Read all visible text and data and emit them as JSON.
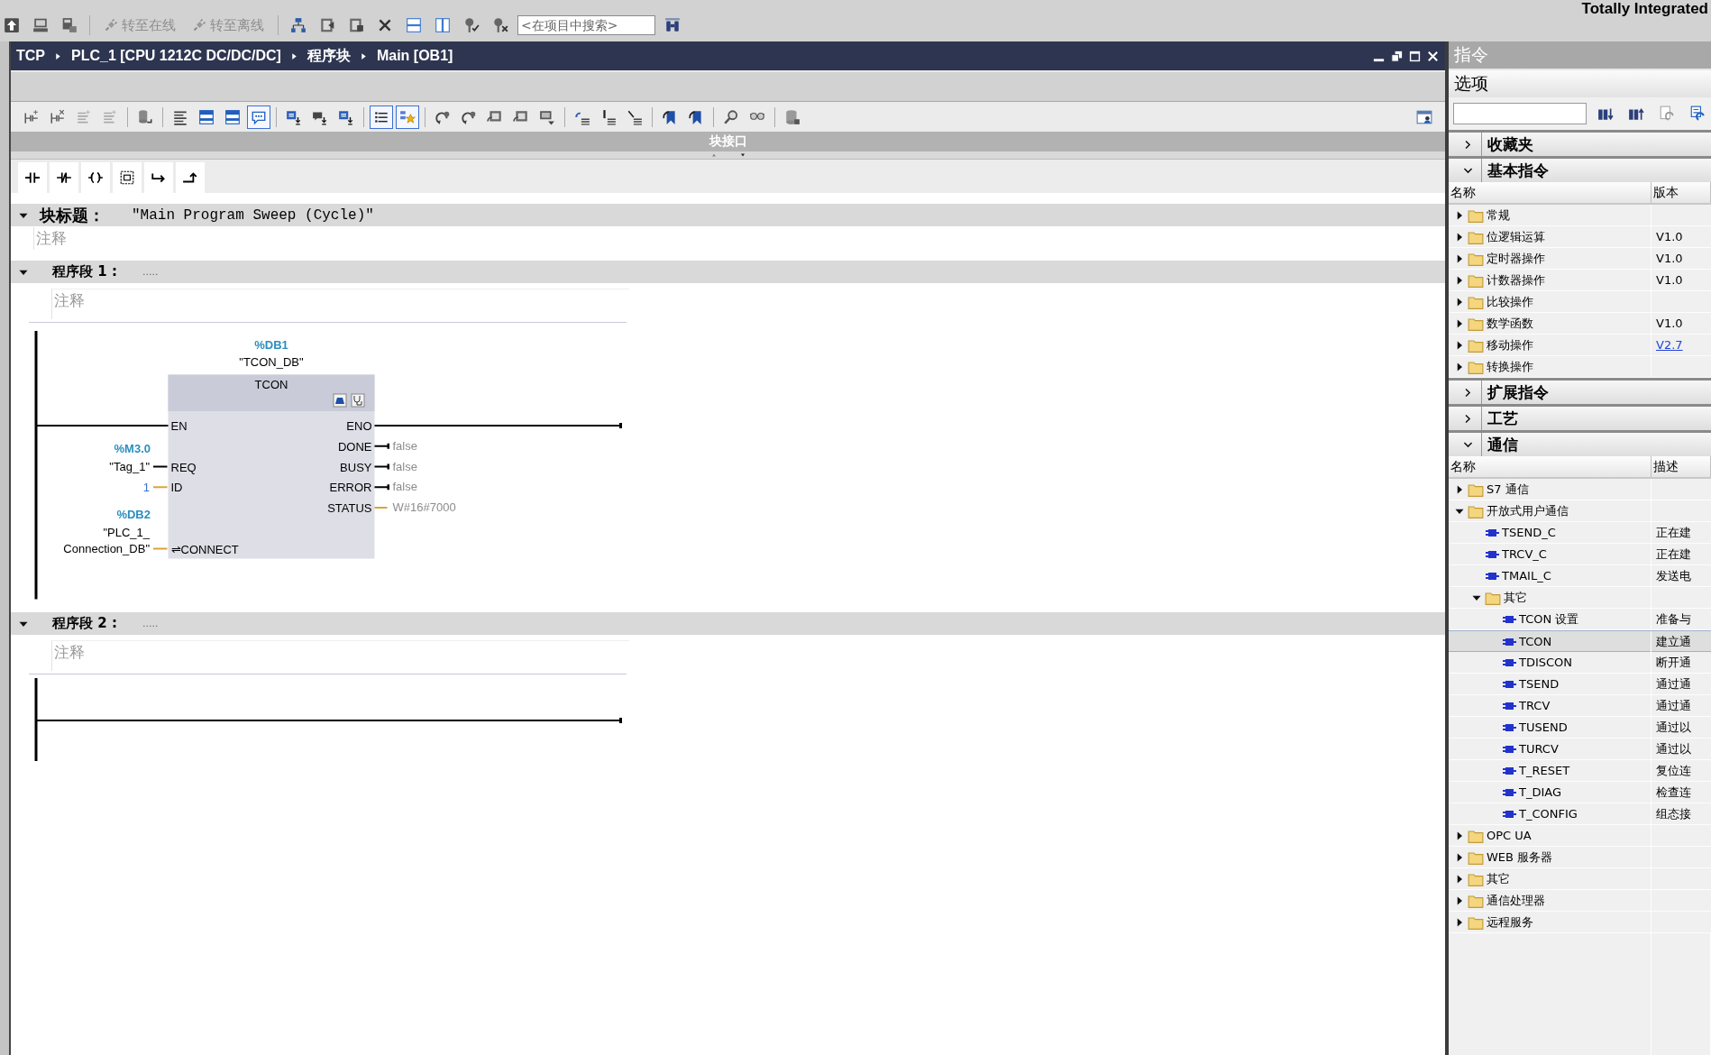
{
  "top_toolbar": {
    "buttons": [
      {
        "label": "转至在线",
        "disabled": true
      },
      {
        "label": "转至离线",
        "disabled": true
      }
    ],
    "search": {
      "placeholder": "<在项目中搜索>"
    }
  },
  "brand": "Totally Integrated",
  "editor": {
    "breadcrumb": [
      "TCP",
      "PLC_1 [CPU 1212C DC/DC/DC]",
      "程序块",
      "Main [OB1]"
    ],
    "toolbar": [
      {
        "on": false
      },
      {
        "on": false
      },
      {
        "on": false
      },
      {
        "on": false
      },
      {
        "on": false
      },
      {
        "on": false
      },
      {
        "on": false
      },
      {
        "on": false
      },
      {
        "on": true
      },
      {
        "on": false
      },
      {
        "on": false
      },
      {
        "on": false
      },
      {
        "on": true
      },
      {
        "on": true
      },
      {
        "on": false
      },
      {
        "on": false
      },
      {
        "on": false
      },
      {
        "on": false
      },
      {
        "on": false
      },
      {
        "on": false
      },
      {
        "on": false
      },
      {
        "on": false
      },
      {
        "on": false
      },
      {
        "on": false
      },
      {
        "on": false
      },
      {
        "on": false
      },
      {
        "on": false
      },
      {
        "on": false
      }
    ],
    "interface_bar": "块接口",
    "block_title": {
      "label": "块标题：",
      "value": "\"Main Program Sweep (Cycle)\"",
      "comment": "注释",
      "expanded": true
    },
    "networks": [
      {
        "title": "程序段 1 :",
        "dots": ".....",
        "comment": "注释",
        "expanded": true,
        "block": {
          "address": "%DB1",
          "instance": "\"TCON_DB\"",
          "type": "TCON",
          "inputs": [
            {
              "pin": "EN",
              "kind": "power"
            },
            {
              "pin": "REQ",
              "kind": "bool",
              "address": "%M3.0",
              "operand": [
                "\"Tag_1\""
              ],
              "constant": false
            },
            {
              "pin": "ID",
              "kind": "word",
              "operand": [
                "1"
              ],
              "constant": true
            },
            {
              "pin": "⇌CONNECT",
              "kind": "inout",
              "address": "%DB2",
              "operand": [
                "\"PLC_1_",
                "Connection_DB\""
              ],
              "constant": false
            }
          ],
          "outputs": [
            {
              "pin": "ENO",
              "kind": "power"
            },
            {
              "pin": "DONE",
              "kind": "bool",
              "value": "false"
            },
            {
              "pin": "BUSY",
              "kind": "bool",
              "value": "false"
            },
            {
              "pin": "ERROR",
              "kind": "bool",
              "value": "false"
            },
            {
              "pin": "STATUS",
              "kind": "word",
              "value": "W#16#7000"
            }
          ]
        }
      },
      {
        "title": "程序段 2 :",
        "dots": ".....",
        "comment": "注释",
        "expanded": true
      }
    ]
  },
  "instructions": {
    "title": "指令",
    "options": "选项",
    "sections": [
      {
        "title": "收藏夹",
        "expanded": false
      },
      {
        "title": "基本指令",
        "expanded": true,
        "columns": [
          "名称",
          "版本"
        ],
        "items": [
          {
            "name": "常规",
            "kind": "folder",
            "expanded": false,
            "selected": false
          },
          {
            "name": "位逻辑运算",
            "kind": "folder",
            "expanded": false,
            "selected": false,
            "version": "V1.0",
            "link": false
          },
          {
            "name": "定时器操作",
            "kind": "folder",
            "expanded": false,
            "selected": false,
            "version": "V1.0",
            "link": false
          },
          {
            "name": "计数器操作",
            "kind": "folder",
            "expanded": false,
            "selected": false,
            "version": "V1.0",
            "link": false
          },
          {
            "name": "比较操作",
            "kind": "folder",
            "expanded": false,
            "selected": false
          },
          {
            "name": "数学函数",
            "kind": "folder",
            "expanded": false,
            "selected": false,
            "version": "V1.0",
            "link": false
          },
          {
            "name": "移动操作",
            "kind": "folder",
            "expanded": false,
            "selected": false,
            "version": "V2.7",
            "link": true
          },
          {
            "name": "转换操作",
            "kind": "folder",
            "expanded": false,
            "selected": false
          }
        ]
      },
      {
        "title": "扩展指令",
        "expanded": false
      },
      {
        "title": "工艺",
        "expanded": false
      },
      {
        "title": "通信",
        "expanded": true,
        "columns": [
          "名称",
          "描述"
        ],
        "items": [
          {
            "name": "S7 通信",
            "kind": "folder",
            "expanded": false,
            "selected": false
          },
          {
            "name": "开放式用户通信",
            "kind": "folder",
            "expanded": true,
            "selected": false,
            "children": [
              {
                "name": "TSEND_C",
                "kind": "block",
                "selected": false,
                "description": "正在建"
              },
              {
                "name": "TRCV_C",
                "kind": "block",
                "selected": false,
                "description": "正在建"
              },
              {
                "name": "TMAIL_C",
                "kind": "block",
                "selected": false,
                "description": "发送电"
              },
              {
                "name": "其它",
                "kind": "folder",
                "expanded": true,
                "selected": false,
                "children": [
                  {
                    "name": "TCON 设置",
                    "kind": "block",
                    "selected": false,
                    "description": "准备与"
                  },
                  {
                    "name": "TCON",
                    "kind": "block",
                    "selected": true,
                    "description": "建立通"
                  },
                  {
                    "name": "TDISCON",
                    "kind": "block",
                    "selected": false,
                    "description": "断开通"
                  },
                  {
                    "name": "TSEND",
                    "kind": "block",
                    "selected": false,
                    "description": "通过通"
                  },
                  {
                    "name": "TRCV",
                    "kind": "block",
                    "selected": false,
                    "description": "通过通"
                  },
                  {
                    "name": "TUSEND",
                    "kind": "block",
                    "selected": false,
                    "description": "通过以"
                  },
                  {
                    "name": "TURCV",
                    "kind": "block",
                    "selected": false,
                    "description": "通过以"
                  },
                  {
                    "name": "T_RESET",
                    "kind": "block",
                    "selected": false,
                    "description": "复位连"
                  },
                  {
                    "name": "T_DIAG",
                    "kind": "block",
                    "selected": false,
                    "description": "检查连"
                  },
                  {
                    "name": "T_CONFIG",
                    "kind": "block",
                    "selected": false,
                    "description": "组态接"
                  }
                ]
              }
            ]
          },
          {
            "name": "OPC UA",
            "kind": "folder",
            "expanded": false,
            "selected": false
          },
          {
            "name": "WEB 服务器",
            "kind": "folder",
            "expanded": false,
            "selected": false
          },
          {
            "name": "其它",
            "kind": "folder",
            "expanded": false,
            "selected": false
          },
          {
            "name": "通信处理器",
            "kind": "folder",
            "expanded": false,
            "selected": false
          },
          {
            "name": "远程服务",
            "kind": "folder",
            "expanded": false,
            "selected": false
          }
        ]
      }
    ]
  }
}
